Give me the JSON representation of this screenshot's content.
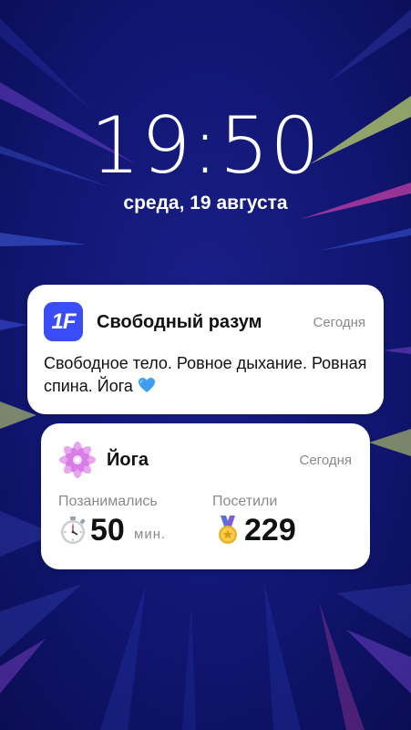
{
  "lockscreen": {
    "time": "19:50",
    "date": "среда, 19 августа"
  },
  "notifications": [
    {
      "app_icon": "1f-app-logo-icon",
      "app_icon_text": "1F",
      "app_name": "Свободный разум",
      "time": "Сегодня",
      "message": "Свободное тело. Ровное дыхание. Ровная спина. Йога",
      "message_emoji": "blue-heart-icon"
    },
    {
      "app_icon": "lotus-icon",
      "app_name": "Йога",
      "time": "Сегодня",
      "stats": [
        {
          "label": "Позанимались",
          "value": "50",
          "unit": "мин.",
          "icon": "stopwatch-icon"
        },
        {
          "label": "Посетили",
          "value": "229",
          "icon": "medal-icon"
        }
      ]
    }
  ],
  "colors": {
    "background": "#0c1060",
    "card": "#ffffff",
    "app_icon_1f": "#3a4cf5",
    "lotus": "#d77de6",
    "secondary_text": "#8a8a8a"
  }
}
